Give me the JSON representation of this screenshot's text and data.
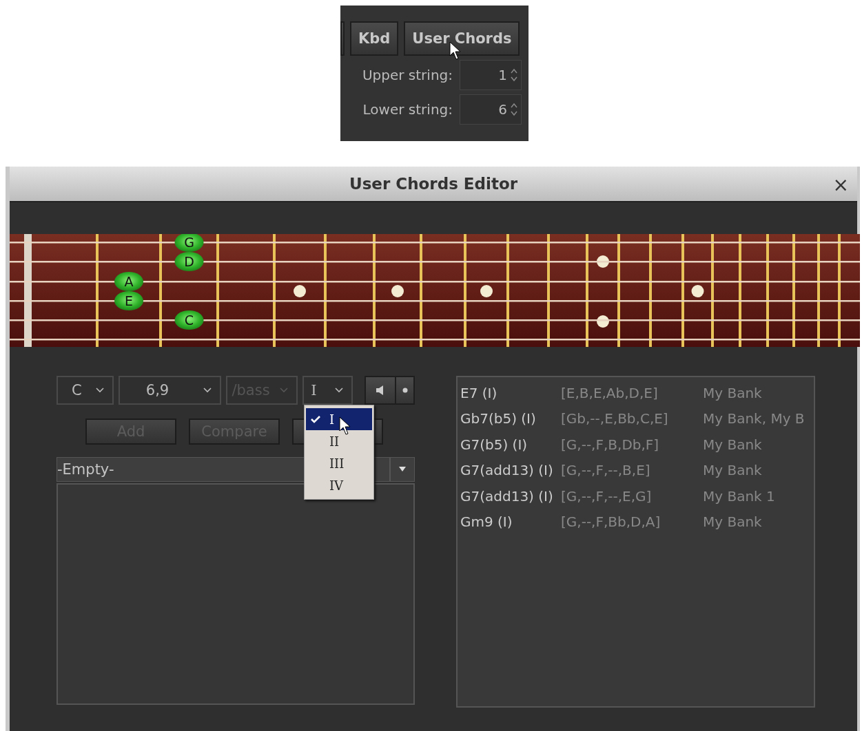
{
  "toolbar": {
    "buttons": [
      {
        "label": "Kbd"
      },
      {
        "label": "User Chords"
      }
    ],
    "spinners": [
      {
        "label": "Upper string:",
        "value": "1"
      },
      {
        "label": "Lower string:",
        "value": "6"
      }
    ]
  },
  "window": {
    "title": "User Chords Editor",
    "close": "×"
  },
  "fretboard": {
    "notes": [
      {
        "label": "G"
      },
      {
        "label": "D"
      },
      {
        "label": "A"
      },
      {
        "label": "E"
      },
      {
        "label": "C"
      }
    ]
  },
  "chord_selectors": [
    {
      "value": "C",
      "disabled": false
    },
    {
      "value": "6,9",
      "disabled": false
    },
    {
      "value": "/bass",
      "disabled": true
    },
    {
      "value": "I",
      "disabled": false
    }
  ],
  "buttons": [
    {
      "label": "Add",
      "disabled": true
    },
    {
      "label": "Compare",
      "disabled": true
    }
  ],
  "inversion_menu": {
    "items": [
      {
        "label": "I",
        "selected": true
      },
      {
        "label": "II",
        "selected": false
      },
      {
        "label": "III",
        "selected": false
      },
      {
        "label": "IV",
        "selected": false
      }
    ]
  },
  "bank": {
    "value": "-Empty-"
  },
  "chord_list": {
    "rows": [
      {
        "name": "E7 (I)",
        "notes": "[E,B,E,Ab,D,E]",
        "bank": "My Bank"
      },
      {
        "name": "Gb7(b5) (I)",
        "notes": "[Gb,--,E,Bb,C,E]",
        "bank": "My Bank, My B"
      },
      {
        "name": "G7(b5) (I)",
        "notes": "[G,--,F,B,Db,F]",
        "bank": "My Bank"
      },
      {
        "name": "G7(add13) (I)",
        "notes": "[G,--,F,--,B,E]",
        "bank": "My Bank"
      },
      {
        "name": "G7(add13) (I)",
        "notes": "[G,--,F,--,E,G]",
        "bank": "My Bank 1"
      },
      {
        "name": "Gm9 (I)",
        "notes": "[G,--,F,Bb,D,A]",
        "bank": "My Bank"
      }
    ]
  }
}
